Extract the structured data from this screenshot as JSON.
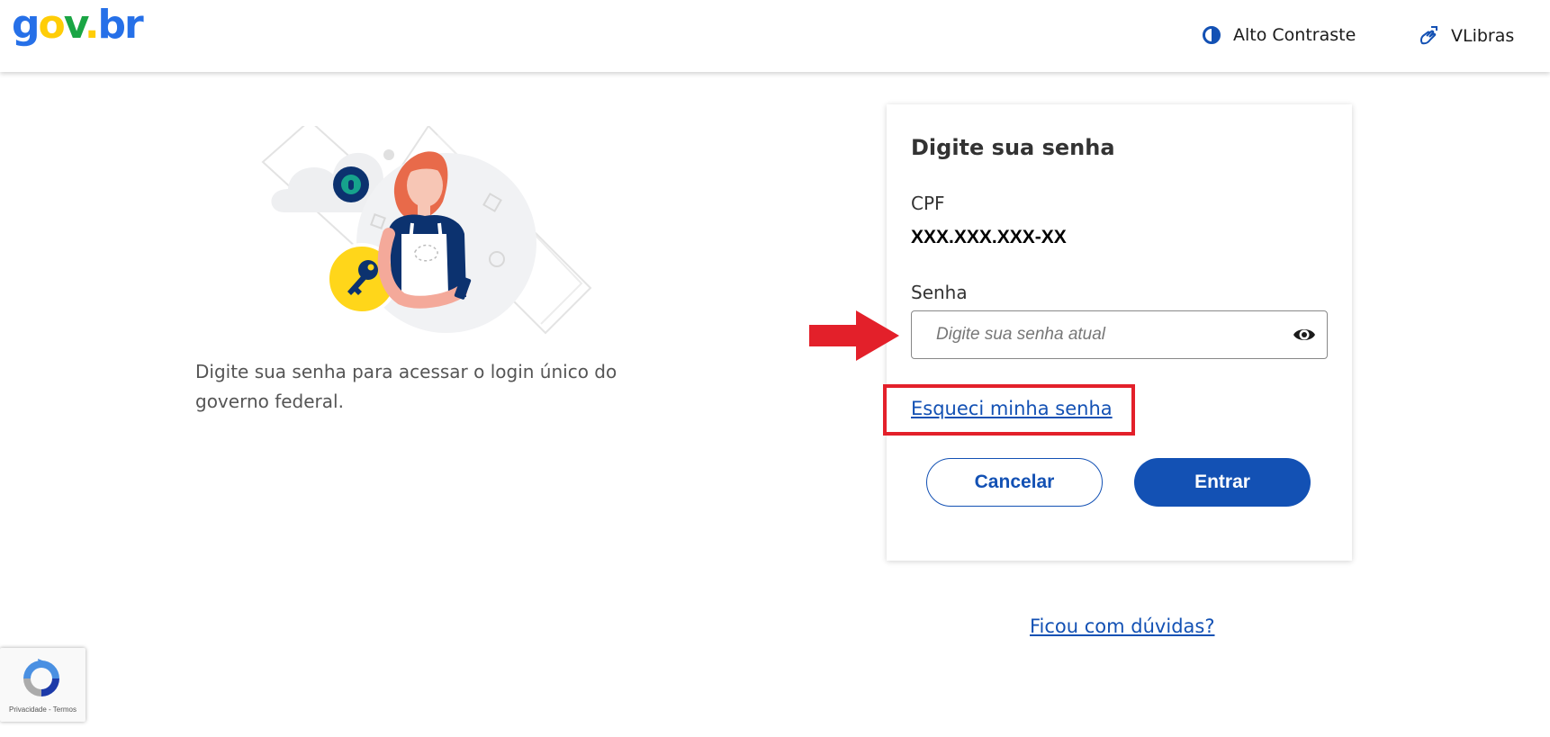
{
  "header": {
    "logo": {
      "g": "g",
      "o": "o",
      "v": "v",
      "dot": ".",
      "br": "br"
    },
    "contrast_label": "Alto Contraste",
    "vlibras_label": "VLibras"
  },
  "intro": {
    "text": "Digite sua senha para acessar o login único do governo federal."
  },
  "card": {
    "title": "Digite sua senha",
    "cpf_label": "CPF",
    "cpf_value": "XXX.XXX.XXX-XX",
    "password_label": "Senha",
    "password_placeholder": "Digite sua senha atual",
    "password_value": "",
    "forgot_label": "Esqueci minha senha",
    "cancel_label": "Cancelar",
    "submit_label": "Entrar"
  },
  "help_label": "Ficou com dúvidas?",
  "recaptcha": {
    "text": "Privacidade - Termos"
  },
  "icons": {
    "contrast": "contrast-icon",
    "vlibras": "hand-sign-icon",
    "password_toggle": "eye-icon",
    "illustration_key": "key-icon",
    "illustration_lock": "lock-icon"
  },
  "colors": {
    "primary": "#1351b4",
    "annotation": "#e3202a",
    "logo_blue": "#2670e8",
    "logo_yellow": "#ffcd07",
    "logo_green": "#1aa544"
  }
}
